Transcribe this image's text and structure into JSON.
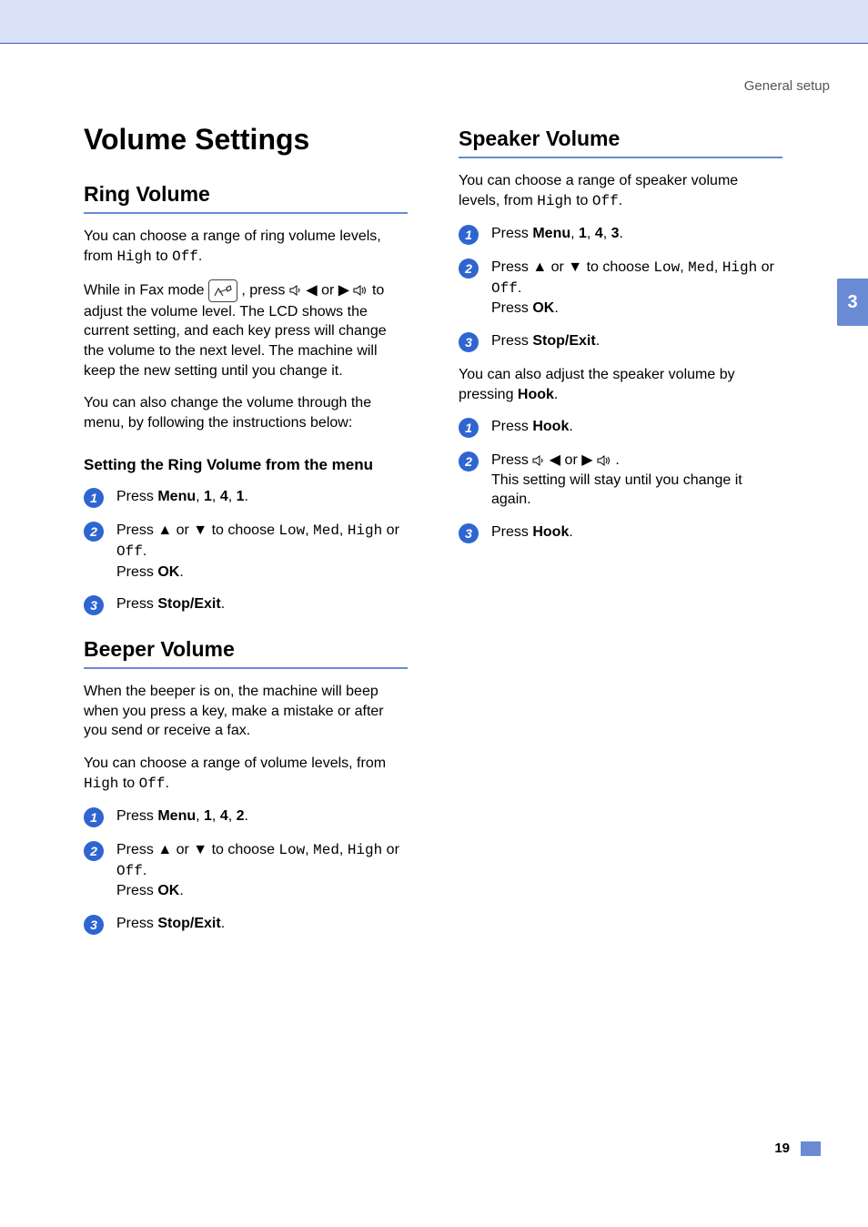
{
  "chapter_label": "General setup",
  "side_tab": "3",
  "page_number": "19",
  "main_heading": "Volume Settings",
  "left": {
    "ring": {
      "heading": "Ring Volume",
      "p1_a": "You can choose a range of ring volume levels, from ",
      "p1_high": "High",
      "p1_mid": " to ",
      "p1_off": "Off",
      "p1_end": ".",
      "p2_a": "While in Fax mode ",
      "p2_b": ", press ",
      "p2_c": " or ",
      "p2_d": " to adjust the volume level. The LCD shows the current setting, and each key press will change the volume to the next level. The machine will keep the new setting until you change it.",
      "p3": "You can also change the volume through the menu, by following the instructions below:",
      "subheading": "Setting the Ring Volume from the menu",
      "step1_a": "Press ",
      "step1_menu": "Menu",
      "step1_b": ", ",
      "step1_n1": "1",
      "step1_c": ", ",
      "step1_n2": "4",
      "step1_d": ", ",
      "step1_n3": "1",
      "step1_e": ".",
      "step2_a": "Press ▲ or ▼ to choose ",
      "step2_low": "Low",
      "step2_b": ", ",
      "step2_med": "Med",
      "step2_c": ", ",
      "step2_high": "High",
      "step2_d": " or ",
      "step2_off": "Off",
      "step2_e": ".",
      "step2_f": "Press ",
      "step2_ok": "OK",
      "step2_g": ".",
      "step3_a": "Press ",
      "step3_stop": "Stop/Exit",
      "step3_b": "."
    },
    "beeper": {
      "heading": "Beeper Volume",
      "p1": "When the beeper is on, the machine will beep when you press a key, make a mistake or after you send or receive a fax.",
      "p2_a": "You can choose a range of volume levels, from ",
      "p2_high": "High",
      "p2_mid": " to ",
      "p2_off": "Off",
      "p2_end": ".",
      "step1_a": "Press ",
      "step1_menu": "Menu",
      "step1_b": ", ",
      "step1_n1": "1",
      "step1_c": ", ",
      "step1_n2": "4",
      "step1_d": ", ",
      "step1_n3": "2",
      "step1_e": ".",
      "step2_a": "Press ▲ or ▼ to choose ",
      "step2_low": "Low",
      "step2_b": ", ",
      "step2_med": "Med",
      "step2_c": ", ",
      "step2_high": "High",
      "step2_d": " or ",
      "step2_off": "Off",
      "step2_e": ".",
      "step2_f": "Press ",
      "step2_ok": "OK",
      "step2_g": ".",
      "step3_a": "Press ",
      "step3_stop": "Stop/Exit",
      "step3_b": "."
    }
  },
  "right": {
    "speaker": {
      "heading": "Speaker Volume",
      "p1_a": "You can choose a range of speaker volume levels, from ",
      "p1_high": "High",
      "p1_mid": " to ",
      "p1_off": "Off",
      "p1_end": ".",
      "step1_a": "Press ",
      "step1_menu": "Menu",
      "step1_b": ", ",
      "step1_n1": "1",
      "step1_c": ", ",
      "step1_n2": "4",
      "step1_d": ", ",
      "step1_n3": "3",
      "step1_e": ".",
      "step2_a": "Press ▲ or ▼ to choose ",
      "step2_low": "Low",
      "step2_b": ", ",
      "step2_med": "Med",
      "step2_c": ", ",
      "step2_high": "High",
      "step2_d": " or ",
      "step2_off": "Off",
      "step2_e": ".",
      "step2_f": "Press ",
      "step2_ok": "OK",
      "step2_g": ".",
      "step3_a": "Press ",
      "step3_stop": "Stop/Exit",
      "step3_b": ".",
      "p2_a": "You can also adjust the speaker volume by pressing ",
      "p2_hook": "Hook",
      "p2_b": ".",
      "hstep1_a": "Press ",
      "hstep1_hook": "Hook",
      "hstep1_b": ".",
      "hstep2_a": "Press ",
      "hstep2_b": " ◀ or ▶ ",
      "hstep2_c": ".",
      "hstep2_d": "This setting will stay until you change it again.",
      "hstep3_a": "Press ",
      "hstep3_hook": "Hook",
      "hstep3_b": "."
    }
  }
}
